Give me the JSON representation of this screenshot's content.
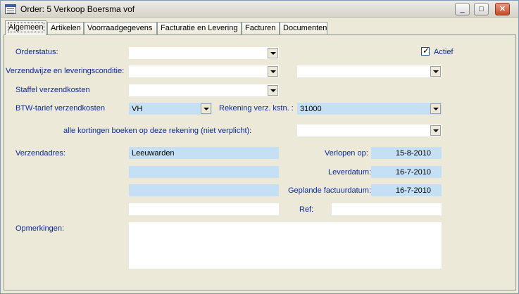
{
  "window": {
    "title": "Order: 5 Verkoop Boersma vof"
  },
  "titlebar_buttons": {
    "minimize": "_",
    "maximize": "□",
    "close": "✕"
  },
  "tabs": [
    {
      "label": "Algemeen",
      "active": true
    },
    {
      "label": "Artikelen",
      "active": false
    },
    {
      "label": "Voorraadgegevens",
      "active": false
    },
    {
      "label": "Facturatie en Levering",
      "active": false
    },
    {
      "label": "Facturen",
      "active": false
    },
    {
      "label": "Documenten",
      "active": false
    }
  ],
  "form": {
    "orderstatus_label": "Orderstatus:",
    "orderstatus_value": "",
    "actief_label": "Actief",
    "actief_checked": true,
    "verzendwijze_label": "Verzendwijze en leveringsconditie:",
    "verzendwijze_value": "",
    "leveringsconditie_value": "",
    "staffel_label": "Staffel verzendkosten",
    "staffel_value": "",
    "btw_label": "BTW-tarief verzendkosten",
    "btw_value": "VH",
    "rekening_label": "Rekening verz. kstn. :",
    "rekening_value": "31000",
    "kortingen_label": "alle kortingen boeken op deze rekening (niet verplicht):",
    "kortingen_value": "",
    "verzendadres_label": "Verzendadres:",
    "address_lines": [
      "Leeuwarden",
      "",
      "",
      ""
    ],
    "verlopen_label": "Verlopen op:",
    "verlopen_value": "15-8-2010",
    "leverdatum_label": "Leverdatum:",
    "leverdatum_value": "16-7-2010",
    "factuurdatum_label": "Geplande factuurdatum:",
    "factuurdatum_value": "16-7-2010",
    "ref_label": "Ref:",
    "ref_value": "",
    "opmerkingen_label": "Opmerkingen:",
    "opmerkingen_value": ""
  },
  "colors": {
    "label_text": "#0a2a9a",
    "highlight_field": "#c5e0f5",
    "panel_bg": "#ece9d8"
  }
}
